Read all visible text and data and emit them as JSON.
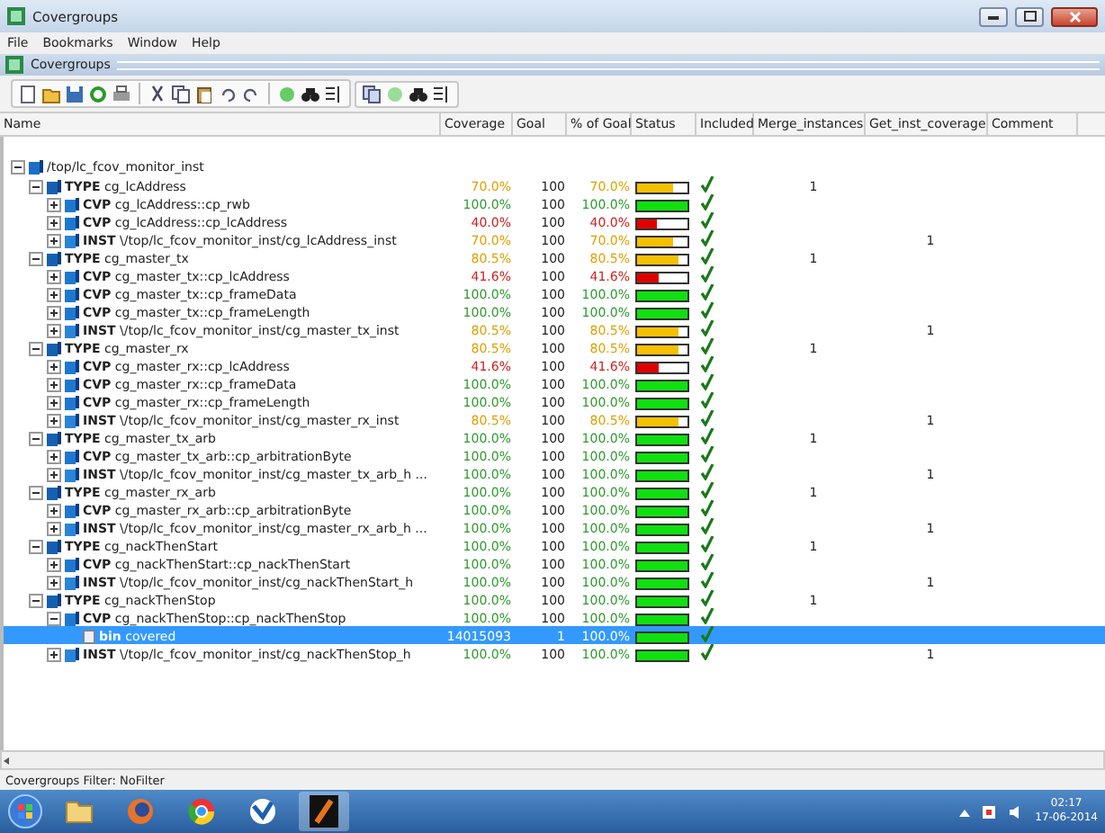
{
  "window": {
    "title": "Covergroups"
  },
  "menu": [
    "File",
    "Bookmarks",
    "Window",
    "Help"
  ],
  "panel": {
    "title": "Covergroups"
  },
  "table": {
    "columns": [
      "Name",
      "Coverage",
      "Goal",
      "% of Goal",
      "Status",
      "Included",
      "Merge_instances",
      "Get_inst_coverage",
      "Comment"
    ],
    "rows": [
      {
        "kind": "instance",
        "name": "/top/lc_fcov_monitor_inst",
        "expanded": true,
        "selected": false,
        "children": [
          {
            "kind": "type",
            "name": "**TYPE** cg_lcAddress",
            "coverage": "70.0%",
            "goal": "100",
            "pct": "70.0%",
            "level": 0.7,
            "included": true,
            "merge": "1",
            "expanded": true,
            "selected": false,
            "children": [
              {
                "kind": "cvp",
                "name": "**CVP** cg_lcAddress::cp_rwb",
                "coverage": "100.0%",
                "goal": "100",
                "pct": "100.0%",
                "level": 1,
                "included": true,
                "expanded": false,
                "selected": false
              },
              {
                "kind": "cvp",
                "name": "**CVP** cg_lcAddress::cp_lcAddress",
                "coverage": "40.0%",
                "goal": "100",
                "pct": "40.0%",
                "level": 0.4,
                "included": true,
                "expanded": false,
                "selected": false
              },
              {
                "kind": "inst",
                "name": "**INST** \\/top/lc_fcov_monitor_inst/cg_lcAddress_inst",
                "coverage": "70.0%",
                "goal": "100",
                "pct": "70.0%",
                "level": 0.7,
                "included": true,
                "get_inst": "1",
                "expanded": false,
                "selected": false
              }
            ]
          },
          {
            "kind": "type",
            "name": "**TYPE** cg_master_tx",
            "coverage": "80.5%",
            "goal": "100",
            "pct": "80.5%",
            "level": 0.805,
            "included": true,
            "merge": "1",
            "expanded": true,
            "selected": false,
            "children": [
              {
                "kind": "cvp",
                "name": "**CVP** cg_master_tx::cp_lcAddress",
                "coverage": "41.6%",
                "goal": "100",
                "pct": "41.6%",
                "level": 0.416,
                "included": true,
                "expanded": false,
                "selected": false
              },
              {
                "kind": "cvp",
                "name": "**CVP** cg_master_tx::cp_frameData",
                "coverage": "100.0%",
                "goal": "100",
                "pct": "100.0%",
                "level": 1,
                "included": true,
                "expanded": false,
                "selected": false
              },
              {
                "kind": "cvp",
                "name": "**CVP** cg_master_tx::cp_frameLength",
                "coverage": "100.0%",
                "goal": "100",
                "pct": "100.0%",
                "level": 1,
                "included": true,
                "expanded": false,
                "selected": false
              },
              {
                "kind": "inst",
                "name": "**INST** \\/top/lc_fcov_monitor_inst/cg_master_tx_inst",
                "coverage": "80.5%",
                "goal": "100",
                "pct": "80.5%",
                "level": 0.805,
                "included": true,
                "get_inst": "1",
                "expanded": false,
                "selected": false
              }
            ]
          },
          {
            "kind": "type",
            "name": "**TYPE** cg_master_rx",
            "coverage": "80.5%",
            "goal": "100",
            "pct": "80.5%",
            "level": 0.805,
            "included": true,
            "merge": "1",
            "expanded": true,
            "selected": false,
            "children": [
              {
                "kind": "cvp",
                "name": "**CVP** cg_master_rx::cp_lcAddress",
                "coverage": "41.6%",
                "goal": "100",
                "pct": "41.6%",
                "level": 0.416,
                "included": true,
                "expanded": false,
                "selected": false
              },
              {
                "kind": "cvp",
                "name": "**CVP** cg_master_rx::cp_frameData",
                "coverage": "100.0%",
                "goal": "100",
                "pct": "100.0%",
                "level": 1,
                "included": true,
                "expanded": false,
                "selected": false
              },
              {
                "kind": "cvp",
                "name": "**CVP** cg_master_rx::cp_frameLength",
                "coverage": "100.0%",
                "goal": "100",
                "pct": "100.0%",
                "level": 1,
                "included": true,
                "expanded": false,
                "selected": false
              },
              {
                "kind": "inst",
                "name": "**INST** \\/top/lc_fcov_monitor_inst/cg_master_rx_inst",
                "coverage": "80.5%",
                "goal": "100",
                "pct": "80.5%",
                "level": 0.805,
                "included": true,
                "get_inst": "1",
                "expanded": false,
                "selected": false
              }
            ]
          },
          {
            "kind": "type",
            "name": "**TYPE** cg_master_tx_arb",
            "coverage": "100.0%",
            "goal": "100",
            "pct": "100.0%",
            "level": 1,
            "included": true,
            "merge": "1",
            "expanded": true,
            "selected": false,
            "children": [
              {
                "kind": "cvp",
                "name": "**CVP** cg_master_tx_arb::cp_arbitrationByte",
                "coverage": "100.0%",
                "goal": "100",
                "pct": "100.0%",
                "level": 1,
                "included": true,
                "expanded": false,
                "selected": false
              },
              {
                "kind": "inst",
                "name": "**INST** \\/top/lc_fcov_monitor_inst/cg_master_tx_arb_h ...",
                "coverage": "100.0%",
                "goal": "100",
                "pct": "100.0%",
                "level": 1,
                "included": true,
                "get_inst": "1",
                "expanded": false,
                "selected": false
              }
            ]
          },
          {
            "kind": "type",
            "name": "**TYPE** cg_master_rx_arb",
            "coverage": "100.0%",
            "goal": "100",
            "pct": "100.0%",
            "level": 1,
            "included": true,
            "merge": "1",
            "expanded": true,
            "selected": false,
            "children": [
              {
                "kind": "cvp",
                "name": "**CVP** cg_master_rx_arb::cp_arbitrationByte",
                "coverage": "100.0%",
                "goal": "100",
                "pct": "100.0%",
                "level": 1,
                "included": true,
                "expanded": false,
                "selected": false
              },
              {
                "kind": "inst",
                "name": "**INST** \\/top/lc_fcov_monitor_inst/cg_master_rx_arb_h ...",
                "coverage": "100.0%",
                "goal": "100",
                "pct": "100.0%",
                "level": 1,
                "included": true,
                "get_inst": "1",
                "expanded": false,
                "selected": false
              }
            ]
          },
          {
            "kind": "type",
            "name": "**TYPE** cg_nackThenStart",
            "coverage": "100.0%",
            "goal": "100",
            "pct": "100.0%",
            "level": 1,
            "included": true,
            "merge": "1",
            "expanded": true,
            "selected": false,
            "children": [
              {
                "kind": "cvp",
                "name": "**CVP** cg_nackThenStart::cp_nackThenStart",
                "coverage": "100.0%",
                "goal": "100",
                "pct": "100.0%",
                "level": 1,
                "included": true,
                "expanded": false,
                "selected": false
              },
              {
                "kind": "inst",
                "name": "**INST** \\/top/lc_fcov_monitor_inst/cg_nackThenStart_h",
                "coverage": "100.0%",
                "goal": "100",
                "pct": "100.0%",
                "level": 1,
                "included": true,
                "get_inst": "1",
                "expanded": false,
                "selected": false
              }
            ]
          },
          {
            "kind": "type",
            "name": "**TYPE** cg_nackThenStop",
            "coverage": "100.0%",
            "goal": "100",
            "pct": "100.0%",
            "level": 1,
            "included": true,
            "merge": "1",
            "expanded": true,
            "selected": false,
            "children": [
              {
                "kind": "cvp",
                "name": "**CVP** cg_nackThenStop::cp_nackThenStop",
                "coverage": "100.0%",
                "goal": "100",
                "pct": "100.0%",
                "level": 1,
                "included": true,
                "expanded": true,
                "selected": false,
                "children": [
                  {
                    "kind": "bin",
                    "name": "**bin** covered",
                    "coverage": "14015093",
                    "goal": "1",
                    "pct": "100.0%",
                    "level": 1,
                    "included": true,
                    "selected": true
                  }
                ]
              },
              {
                "kind": "inst",
                "name": "**INST** \\/top/lc_fcov_monitor_inst/cg_nackThenStop_h",
                "coverage": "100.0%",
                "goal": "100",
                "pct": "100.0%",
                "level": 1,
                "included": true,
                "get_inst": "1",
                "expanded": false,
                "selected": false
              }
            ]
          }
        ]
      }
    ]
  },
  "status_bar": "Covergroups Filter: NoFilter",
  "taskbar": {
    "time": "02:17",
    "date": "17-06-2014"
  }
}
